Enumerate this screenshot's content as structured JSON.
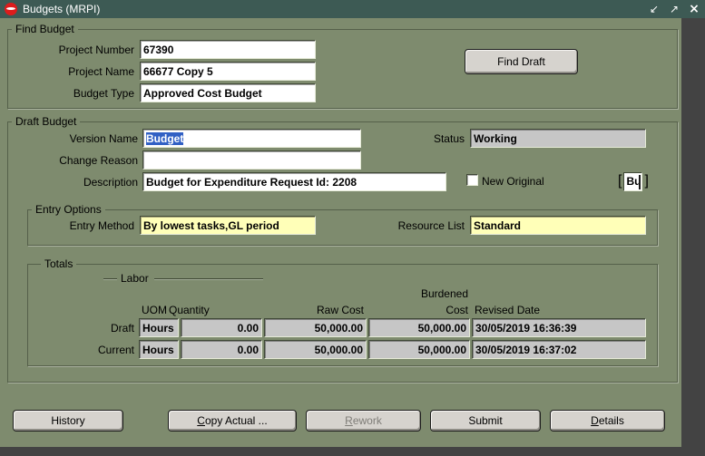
{
  "window": {
    "title": "Budgets (MRPI)"
  },
  "icons": {
    "oracle_logo": "oracle-red-ball",
    "restore": "↙",
    "maximize": "↗",
    "close": "×"
  },
  "find_budget": {
    "legend": "Find Budget",
    "project_number_label": "Project Number",
    "project_number_value": "67390",
    "project_name_label": "Project Name",
    "project_name_value": "66677 Copy 5",
    "budget_type_label": "Budget Type",
    "budget_type_value": "Approved Cost Budget",
    "find_draft_button": "Find Draft"
  },
  "draft_budget": {
    "legend": "Draft Budget",
    "version_name_label": "Version Name",
    "version_name_value": "Budget",
    "status_label": "Status",
    "status_value": "Working",
    "change_reason_label": "Change Reason",
    "change_reason_value": "",
    "description_label": "Description",
    "description_value": "Budget for Expenditure Request Id: 2208",
    "new_original_label": "New Original",
    "new_original_checked": false,
    "clipped_button_text": "Bu"
  },
  "entry_options": {
    "legend": "Entry Options",
    "entry_method_label": "Entry Method",
    "entry_method_value": "By lowest tasks,GL period",
    "resource_list_label": "Resource List",
    "resource_list_value": "Standard"
  },
  "totals": {
    "legend": "Totals",
    "labor_label": "Labor",
    "burdened_label": "Burdened",
    "uom_header": "UOM",
    "quantity_header": "Quantity",
    "raw_cost_header": "Raw Cost",
    "cost_header": "Cost",
    "revised_date_header": "Revised Date",
    "rows": [
      {
        "label": "Draft",
        "uom": "Hours",
        "quantity": "0.00",
        "raw_cost": "50,000.00",
        "burdened_cost": "50,000.00",
        "revised_date": "30/05/2019 16:36:39"
      },
      {
        "label": "Current",
        "uom": "Hours",
        "quantity": "0.00",
        "raw_cost": "50,000.00",
        "burdened_cost": "50,000.00",
        "revised_date": "30/05/2019 16:37:02"
      }
    ]
  },
  "action_buttons": {
    "history": "History",
    "copy_actual": "Copy Actual ...",
    "rework": "Rework",
    "submit": "Submit",
    "details": "Details"
  },
  "colors": {
    "form_background": "#7e8b6e",
    "titlebar": "#3d5a54",
    "required_field_yellow": "#ffffb8",
    "readonly_field_gray": "#c6c6c6",
    "selection_blue": "#3160c4",
    "mdi_background": "#434343",
    "button_face": "#d6d3ce",
    "oracle_logo_red": "#dd1c1c"
  }
}
